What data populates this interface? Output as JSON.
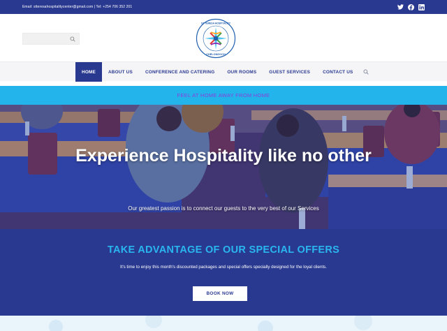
{
  "topbar": {
    "contact": "Email: stteresahospitalitycenter@gmail.com | Tel: +254 706 352 201",
    "social_icons": [
      "twitter-icon",
      "facebook-icon",
      "linkedin-icon"
    ]
  },
  "header": {
    "search_icon": "search-icon",
    "logo_text_top": "ST TERESA HOSPITALITY CENTER",
    "logo_text_bottom": "CHELONGOCH"
  },
  "nav": {
    "items": [
      {
        "label": "HOME",
        "active": true
      },
      {
        "label": "ABOUT US"
      },
      {
        "label": "CONFERENCE AND CATERING"
      },
      {
        "label": "OUR ROOMS"
      },
      {
        "label": "GUEST SERVICES"
      },
      {
        "label": "CONTACT US"
      }
    ]
  },
  "banner": {
    "text": "FEEL AT HOME AWAY FROM HOME"
  },
  "hero": {
    "title": "Experience Hospitality like no other",
    "subtitle": "Our greatest passion is to connect our guests to the very best of our Services"
  },
  "offers": {
    "title": "TAKE ADVANTAGE OF OUR SPECIAL OFFERS",
    "text": "It's time to enjoy this month's discounted packages and special offers specially designed for the loyal clients.",
    "button": "BOOK NOW"
  },
  "colors": {
    "primary": "#2a3990",
    "accent": "#29b6ef",
    "banner_text": "#8a3fd8"
  }
}
